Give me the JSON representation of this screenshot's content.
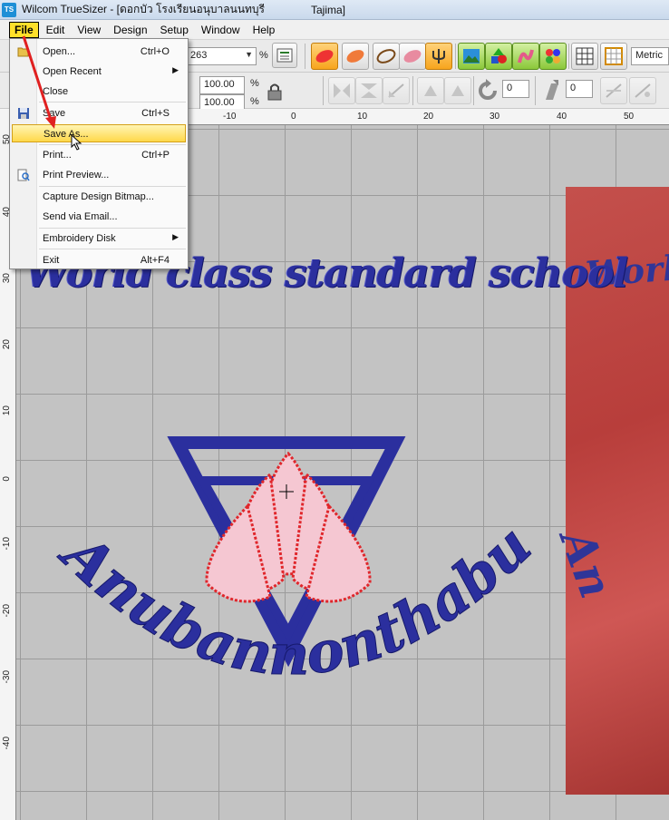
{
  "window": {
    "app_abbr": "TS",
    "title": "Wilcom TrueSizer - [ดอกบัว โรงเรียนอนุบาลนนทบุรี",
    "title_suffix": "Tajima]"
  },
  "menubar": {
    "items": [
      "File",
      "Edit",
      "View",
      "Design",
      "Setup",
      "Window",
      "Help"
    ],
    "active": "File"
  },
  "toolbar": {
    "zoom_value": "263",
    "percent": "%",
    "width_value": "100.00",
    "height_value": "100.00",
    "rotate_value": "0",
    "slant_value": "0",
    "units": "Metric"
  },
  "file_menu": {
    "open": {
      "label": "Open...",
      "shortcut": "Ctrl+O"
    },
    "open_recent": {
      "label": "Open Recent"
    },
    "close": {
      "label": "Close"
    },
    "save": {
      "label": "Save",
      "shortcut": "Ctrl+S"
    },
    "save_as": {
      "label": "Save As..."
    },
    "print": {
      "label": "Print...",
      "shortcut": "Ctrl+P"
    },
    "print_preview": {
      "label": "Print Preview..."
    },
    "capture": {
      "label": "Capture Design Bitmap..."
    },
    "send_email": {
      "label": "Send via Email..."
    },
    "embroidery_disk": {
      "label": "Embroidery Disk"
    },
    "exit": {
      "label": "Exit",
      "shortcut": "Alt+F4"
    }
  },
  "ruler_top": [
    "-10",
    "0",
    "10",
    "20",
    "30",
    "40",
    "50"
  ],
  "ruler_left": [
    "50",
    "40",
    "30",
    "20",
    "10",
    "0",
    "-10",
    "-20",
    "-30",
    "-40"
  ],
  "design": {
    "top_text": "World class standard school",
    "arc_text": "Anubannonthaburi",
    "photo_text_1": "Worl",
    "photo_text_2": "An",
    "thread_blue": "#2b2f9e",
    "petal_pink": "#f5c7d2",
    "outline_red": "#e0262b",
    "fabric_red": "#c4504c"
  },
  "annotation_color": "#e02020"
}
